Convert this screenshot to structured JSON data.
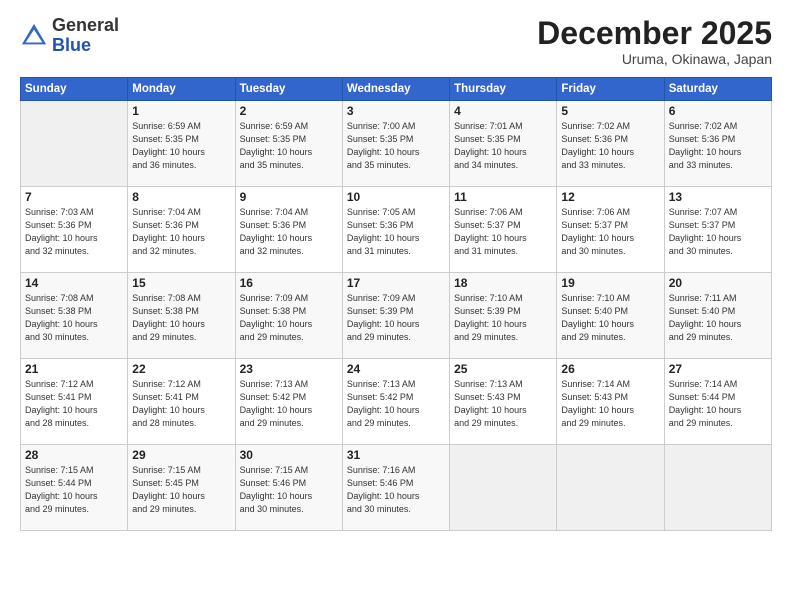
{
  "header": {
    "logo_general": "General",
    "logo_blue": "Blue",
    "month_title": "December 2025",
    "location": "Uruma, Okinawa, Japan"
  },
  "days_of_week": [
    "Sunday",
    "Monday",
    "Tuesday",
    "Wednesday",
    "Thursday",
    "Friday",
    "Saturday"
  ],
  "weeks": [
    [
      {
        "day": "",
        "detail": ""
      },
      {
        "day": "1",
        "detail": "Sunrise: 6:59 AM\nSunset: 5:35 PM\nDaylight: 10 hours\nand 36 minutes."
      },
      {
        "day": "2",
        "detail": "Sunrise: 6:59 AM\nSunset: 5:35 PM\nDaylight: 10 hours\nand 35 minutes."
      },
      {
        "day": "3",
        "detail": "Sunrise: 7:00 AM\nSunset: 5:35 PM\nDaylight: 10 hours\nand 35 minutes."
      },
      {
        "day": "4",
        "detail": "Sunrise: 7:01 AM\nSunset: 5:35 PM\nDaylight: 10 hours\nand 34 minutes."
      },
      {
        "day": "5",
        "detail": "Sunrise: 7:02 AM\nSunset: 5:36 PM\nDaylight: 10 hours\nand 33 minutes."
      },
      {
        "day": "6",
        "detail": "Sunrise: 7:02 AM\nSunset: 5:36 PM\nDaylight: 10 hours\nand 33 minutes."
      }
    ],
    [
      {
        "day": "7",
        "detail": "Sunrise: 7:03 AM\nSunset: 5:36 PM\nDaylight: 10 hours\nand 32 minutes."
      },
      {
        "day": "8",
        "detail": "Sunrise: 7:04 AM\nSunset: 5:36 PM\nDaylight: 10 hours\nand 32 minutes."
      },
      {
        "day": "9",
        "detail": "Sunrise: 7:04 AM\nSunset: 5:36 PM\nDaylight: 10 hours\nand 32 minutes."
      },
      {
        "day": "10",
        "detail": "Sunrise: 7:05 AM\nSunset: 5:36 PM\nDaylight: 10 hours\nand 31 minutes."
      },
      {
        "day": "11",
        "detail": "Sunrise: 7:06 AM\nSunset: 5:37 PM\nDaylight: 10 hours\nand 31 minutes."
      },
      {
        "day": "12",
        "detail": "Sunrise: 7:06 AM\nSunset: 5:37 PM\nDaylight: 10 hours\nand 30 minutes."
      },
      {
        "day": "13",
        "detail": "Sunrise: 7:07 AM\nSunset: 5:37 PM\nDaylight: 10 hours\nand 30 minutes."
      }
    ],
    [
      {
        "day": "14",
        "detail": "Sunrise: 7:08 AM\nSunset: 5:38 PM\nDaylight: 10 hours\nand 30 minutes."
      },
      {
        "day": "15",
        "detail": "Sunrise: 7:08 AM\nSunset: 5:38 PM\nDaylight: 10 hours\nand 29 minutes."
      },
      {
        "day": "16",
        "detail": "Sunrise: 7:09 AM\nSunset: 5:38 PM\nDaylight: 10 hours\nand 29 minutes."
      },
      {
        "day": "17",
        "detail": "Sunrise: 7:09 AM\nSunset: 5:39 PM\nDaylight: 10 hours\nand 29 minutes."
      },
      {
        "day": "18",
        "detail": "Sunrise: 7:10 AM\nSunset: 5:39 PM\nDaylight: 10 hours\nand 29 minutes."
      },
      {
        "day": "19",
        "detail": "Sunrise: 7:10 AM\nSunset: 5:40 PM\nDaylight: 10 hours\nand 29 minutes."
      },
      {
        "day": "20",
        "detail": "Sunrise: 7:11 AM\nSunset: 5:40 PM\nDaylight: 10 hours\nand 29 minutes."
      }
    ],
    [
      {
        "day": "21",
        "detail": "Sunrise: 7:12 AM\nSunset: 5:41 PM\nDaylight: 10 hours\nand 28 minutes."
      },
      {
        "day": "22",
        "detail": "Sunrise: 7:12 AM\nSunset: 5:41 PM\nDaylight: 10 hours\nand 28 minutes."
      },
      {
        "day": "23",
        "detail": "Sunrise: 7:13 AM\nSunset: 5:42 PM\nDaylight: 10 hours\nand 29 minutes."
      },
      {
        "day": "24",
        "detail": "Sunrise: 7:13 AM\nSunset: 5:42 PM\nDaylight: 10 hours\nand 29 minutes."
      },
      {
        "day": "25",
        "detail": "Sunrise: 7:13 AM\nSunset: 5:43 PM\nDaylight: 10 hours\nand 29 minutes."
      },
      {
        "day": "26",
        "detail": "Sunrise: 7:14 AM\nSunset: 5:43 PM\nDaylight: 10 hours\nand 29 minutes."
      },
      {
        "day": "27",
        "detail": "Sunrise: 7:14 AM\nSunset: 5:44 PM\nDaylight: 10 hours\nand 29 minutes."
      }
    ],
    [
      {
        "day": "28",
        "detail": "Sunrise: 7:15 AM\nSunset: 5:44 PM\nDaylight: 10 hours\nand 29 minutes."
      },
      {
        "day": "29",
        "detail": "Sunrise: 7:15 AM\nSunset: 5:45 PM\nDaylight: 10 hours\nand 29 minutes."
      },
      {
        "day": "30",
        "detail": "Sunrise: 7:15 AM\nSunset: 5:46 PM\nDaylight: 10 hours\nand 30 minutes."
      },
      {
        "day": "31",
        "detail": "Sunrise: 7:16 AM\nSunset: 5:46 PM\nDaylight: 10 hours\nand 30 minutes."
      },
      {
        "day": "",
        "detail": ""
      },
      {
        "day": "",
        "detail": ""
      },
      {
        "day": "",
        "detail": ""
      }
    ]
  ]
}
